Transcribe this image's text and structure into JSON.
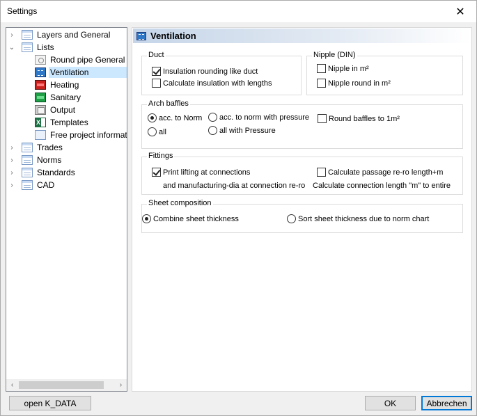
{
  "window": {
    "title": "Settings",
    "close_glyph": "✕"
  },
  "tree": {
    "items": [
      {
        "label": "Layers and General",
        "toggle": "›",
        "icon": "table-icon"
      },
      {
        "label": "Lists",
        "toggle": "⌄",
        "icon": "table-icon"
      },
      {
        "label": "Round pipe General",
        "icon": "pipe-icon"
      },
      {
        "label": "Ventilation",
        "icon": "ventilation-icon"
      },
      {
        "label": "Heating",
        "icon": "heating-icon"
      },
      {
        "label": "Sanitary",
        "icon": "sanitary-icon"
      },
      {
        "label": "Output",
        "icon": "output-icon"
      },
      {
        "label": "Templates",
        "icon": "excel-icon"
      },
      {
        "label": "Free project informat",
        "icon": "document-icon"
      },
      {
        "label": "Trades",
        "toggle": "›",
        "icon": "table-icon"
      },
      {
        "label": "Norms",
        "toggle": "›",
        "icon": "table-icon"
      },
      {
        "label": "Standards",
        "toggle": "›",
        "icon": "table-icon"
      },
      {
        "label": "CAD",
        "toggle": "›",
        "icon": "table-icon"
      }
    ],
    "selected": "Ventilation",
    "scroll_left": "‹",
    "scroll_right": "›"
  },
  "panel": {
    "title": "Ventilation",
    "duct": {
      "title": "Duct",
      "insulation_rounding": {
        "label": "Insulation rounding like duct",
        "checked": true
      },
      "calc_insulation": {
        "label": "Calculate insulation with lengths",
        "checked": false
      }
    },
    "nipple": {
      "title": "Nipple (DIN)",
      "nipple_m2": {
        "label": "Nipple in m²",
        "checked": false
      },
      "nipple_round": {
        "label": "Nipple round  in m²",
        "checked": false
      }
    },
    "arch_baffles": {
      "title": "Arch baffles",
      "acc_norm": {
        "label": "acc. to Norm",
        "checked": true
      },
      "acc_norm_pressure": {
        "label": "acc. to norm with pressure",
        "checked": false
      },
      "round_baffles": {
        "label": "Round baffles to 1m²",
        "checked": false
      },
      "all": {
        "label": "all",
        "checked": false
      },
      "all_pressure": {
        "label": "all with Pressure",
        "checked": false
      }
    },
    "fittings": {
      "title": "Fittings",
      "print_lifting": {
        "label": "Print lifting at connections",
        "checked": true
      },
      "print_lifting_line2": "and manufacturing-dia at connection re-ro",
      "calc_passage": {
        "label": "Calculate passage re-ro length+m",
        "checked": false
      },
      "calc_passage_line2": "Calculate connection length \"m\" to entire"
    },
    "sheet": {
      "title": "Sheet composition",
      "combine": {
        "label": "Combine sheet thickness",
        "checked": true
      },
      "sort": {
        "label": "Sort sheet thickness due to norm chart",
        "checked": false
      }
    }
  },
  "buttons": {
    "open_kdata": "open K_DATA",
    "ok": "OK",
    "cancel": "Abbrechen"
  },
  "colors": {
    "accent": "#0078d7",
    "selection": "#cce8ff"
  }
}
